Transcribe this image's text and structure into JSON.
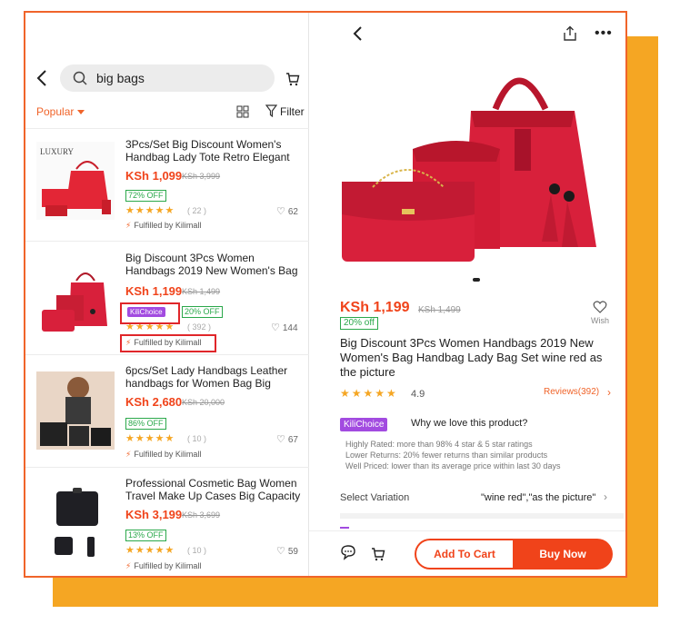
{
  "search": {
    "query": "big bags"
  },
  "sort": {
    "label": "Popular",
    "filter_label": "Filter"
  },
  "products": [
    {
      "title": "3Pcs/Set Big Discount Women's Handbag Lady Tote Retro Elegant",
      "price": "KSh 1,099",
      "old_price": "KSh 3,999",
      "discount": "72% OFF",
      "stars": "★★★★★",
      "reviews": "( 22 )",
      "likes": "62",
      "fulfilled": "Fulfilled by Kilimall",
      "thumb_text": "LUXURY"
    },
    {
      "title": "Big Discount 3Pcs Women Handbags 2019 New Women's Bag",
      "price": "KSh 1,199",
      "old_price": "KSh 1,499",
      "badge": "KiliChoice",
      "discount": "20% OFF",
      "stars": "★★★★★",
      "reviews": "( 392 )",
      "likes": "144",
      "fulfilled": "Fulfilled by Kilimall"
    },
    {
      "title": "6pcs/Set Lady Handbags Leather handbags for Women Bag Big",
      "price": "KSh 2,680",
      "old_price": "KSh 20,000",
      "discount": "86% OFF",
      "stars": "★★★★★",
      "reviews": "( 10 )",
      "likes": "67",
      "fulfilled": "Fulfilled by Kilimall"
    },
    {
      "title": "Professional Cosmetic Bag Women Travel Make Up Cases Big Capacity",
      "price": "KSh 3,199",
      "old_price": "KSh 3,699",
      "discount": "13% OFF",
      "stars": "★★★★★",
      "reviews": "( 10 )",
      "likes": "59",
      "fulfilled": "Fulfilled by Kilimall"
    }
  ],
  "detail": {
    "price": "KSh 1,199",
    "old_price": "KSh 1,499",
    "discount": "20% off",
    "wish_label": "Wish",
    "title": "Big Discount 3Pcs Women Handbags 2019 New Women's Bag Handbag Lady Bag Set wine red as the picture",
    "stars": "★★★★★",
    "rating": "4.9",
    "reviews_link": "Reviews(392)",
    "badge": "KiliChoice",
    "why_love": "Why we love this product?",
    "points": [
      "Highly Rated: more than 98% 4 star & 5 star ratings",
      "Lower Returns: 20% fewer returns than similar products",
      "Well Priced: lower than its average price within last 30 days"
    ],
    "variation_label": "Select Variation",
    "variation_value": "\"wine red\",\"as the picture\"",
    "add_to_cart": "Add To Cart",
    "buy_now": "Buy Now"
  },
  "colors": {
    "accent": "#f0431a",
    "orange": "#f0642a",
    "backdrop": "#f5a623",
    "kili_purple": "#a24be0",
    "green": "#2aa84a",
    "bag_red": "#d8203b"
  }
}
